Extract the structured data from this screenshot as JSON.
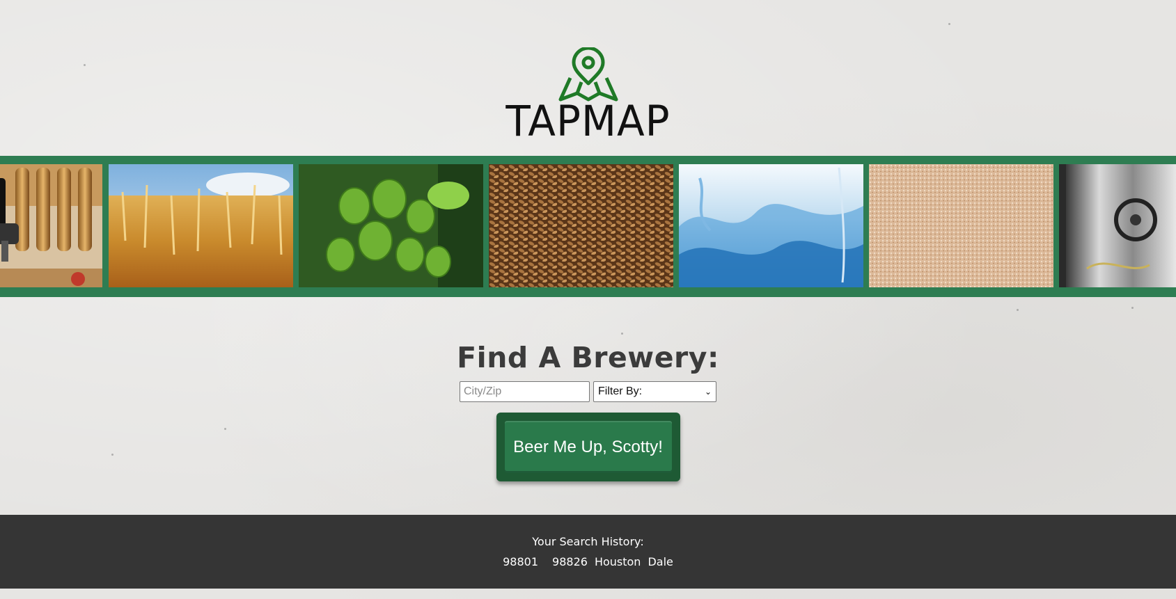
{
  "brand": {
    "name": "TAPMAP",
    "icon": "map-pin-icon",
    "accent": "#1f7a27"
  },
  "strip": {
    "color": "#2e7d52",
    "images": [
      {
        "name": "beer-taps-image"
      },
      {
        "name": "wheat-field-image"
      },
      {
        "name": "hops-image"
      },
      {
        "name": "barley-grain-image"
      },
      {
        "name": "water-splash-image"
      },
      {
        "name": "yeast-image"
      },
      {
        "name": "brewing-tank-image"
      }
    ]
  },
  "finder": {
    "title": "Find A Brewery:",
    "city_placeholder": "City/Zip",
    "city_value": "",
    "filter_selected": "Filter By:",
    "submit_label": "Beer Me Up, Scotty!",
    "button_color": "#2a7a4b"
  },
  "history": {
    "label": "Your Search History:",
    "items": [
      "98801",
      "98826",
      "Houston",
      "Dale"
    ]
  }
}
